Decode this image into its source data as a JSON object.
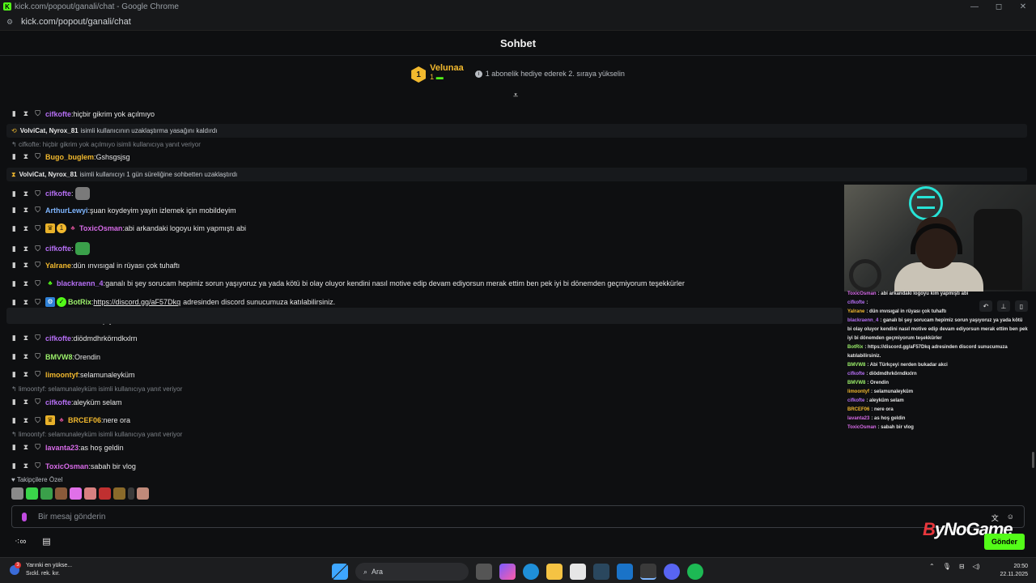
{
  "browser": {
    "window_title": "kick.com/popout/ganali/chat - Google Chrome",
    "url": "kick.com/popout/ganali/chat"
  },
  "header": {
    "title": "Sohbet"
  },
  "top_gifter": {
    "rank": "1",
    "name": "Velunaa",
    "count": "1",
    "message": "1 abonelik hediye ederek 2. sıraya yükselin"
  },
  "colors": {
    "accent": "#53fc18",
    "purple": "#b66ff5",
    "blue_user": "#7fb6ff",
    "yellow_user": "#f2b92e",
    "green_user": "#9cf06b",
    "pink_user": "#d76be8"
  },
  "chat": {
    "messages": [
      {
        "type": "msg",
        "user": "cifkofte",
        "color": "#b66ff5",
        "text": "hiçbir gikrim yok açılmıyo"
      },
      {
        "type": "sys",
        "actors": "VolviCat, Nyrox_81",
        "text": "isimli kullanıcının uzaklaştırma yasağını kaldırdı",
        "icon": "unban-icon"
      },
      {
        "type": "reply",
        "text": "cifkofte: hiçbir gikrim yok açılmıyo isimli kullanıcıya yanıt veriyor"
      },
      {
        "type": "msg",
        "user": "Bugo_buglem",
        "color": "#f2b92e",
        "text": "Gshsgsjsg"
      },
      {
        "type": "sys",
        "actors": "VolviCat, Nyrox_81",
        "text": "isimli kullanıcıyı 1 gün süreliğine sohbetten uzaklaştırdı",
        "icon": "timeout-icon"
      },
      {
        "type": "msg",
        "user": "cifkofte",
        "color": "#b66ff5",
        "text": ""
      },
      {
        "type": "msg",
        "user": "ArthurLewyi",
        "color": "#7fb6ff",
        "text": "şuan koydeyim yayin izlemek için mobildeyim"
      },
      {
        "type": "msg",
        "user": "ToxicOsman",
        "color": "#d76be8",
        "text": "abi arkandaki logoyu kim yapmıştı abi"
      },
      {
        "type": "msg",
        "user": "cifkofte",
        "color": "#b66ff5",
        "text": ""
      },
      {
        "type": "msg",
        "user": "Yalrane",
        "color": "#f2b92e",
        "text": "dün ınvısıgal in rüyası çok tuhaftı"
      },
      {
        "type": "msg",
        "user": "blackraenn_4",
        "color": "#b66ff5",
        "text": "ganalı bi şey sorucam hepimiz sorun yaşıyoruz ya yada kötü bi olay oluyor kendini nasıl motive edip devam ediyorsun merak ettim ben pek iyi bi dönemden geçmiyorum teşekkürler"
      },
      {
        "type": "msg",
        "user": "BotRix",
        "color": "#9cf06b",
        "link": "https://discord.gg/aF57Dkq",
        "text": "adresinden discord sunucumuza katılabilirsiniz."
      },
      {
        "type": "msg",
        "user": "BMVW8",
        "color": "#9cf06b",
        "text": "Abi Türkçeyi nerden bukadar akci"
      },
      {
        "type": "msg",
        "user": "cifkofte",
        "color": "#b66ff5",
        "text": "diödmdhrkörndkxlrn"
      },
      {
        "type": "msg",
        "user": "BMVW8",
        "color": "#9cf06b",
        "text": "Orendin"
      },
      {
        "type": "msg",
        "user": "limoontyf",
        "color": "#f2b92e",
        "text": "selamunaleyküm"
      },
      {
        "type": "reply",
        "text": "limoontyf: selamunaleyküm isimli kullanıcıya yanıt veriyor"
      },
      {
        "type": "msg",
        "user": "cifkofte",
        "color": "#b66ff5",
        "text": "aleyküm selam"
      },
      {
        "type": "msg",
        "user": "BRCEF06",
        "color": "#f2b92e",
        "text": "nere ora"
      },
      {
        "type": "reply",
        "text": "limoontyf: selamunaleyküm isimli kullanıcıya yanıt veriyor"
      },
      {
        "type": "msg",
        "user": "lavanta23",
        "color": "#d76be8",
        "text": "as hoş geldin"
      },
      {
        "type": "msg",
        "user": "ToxicOsman",
        "color": "#d76be8",
        "text": "sabah bir vlog"
      }
    ]
  },
  "followers_label": "Takipçilere Özel",
  "input": {
    "placeholder": "Bir mesaj gönderin",
    "send_label": "Gönder"
  },
  "watermark": {
    "part1": "B",
    "part2": "yNoGame"
  },
  "overlay": {
    "lines": [
      {
        "user": "ToxicOsman",
        "text": "abi arkandaki logoyu kim yapmıştı abi"
      },
      {
        "user": "cifkofte",
        "text": ""
      },
      {
        "user": "Yalrane",
        "text": "dün ınvısıgal in rüyası çok tuhaftı"
      },
      {
        "user": "blackraenn_4",
        "text": "ganalı bi şey sorucam hepimiz sorun yaşıyoruz ya yada kötü"
      },
      {
        "user": "",
        "text": "bi olay oluyor kendini nasıl motive edip devam ediyorsun merak ettim ben pek"
      },
      {
        "user": "",
        "text": "iyi bi dönemden geçmiyorum teşekkürler"
      },
      {
        "user": "BotRix",
        "text": "https://discord.gg/aF57Dkq adresinden discord sunucumuza"
      },
      {
        "user": "",
        "text": "katılabilirsiniz."
      },
      {
        "user": "BMVW8",
        "text": "Abi Türkçeyi nerden bukadar akci"
      },
      {
        "user": "cifkofte",
        "text": "diödmdhrkörndkxlrn"
      },
      {
        "user": "BMVW8",
        "text": "Orendin"
      },
      {
        "user": "limoontyf",
        "text": "selamunaleyküm"
      },
      {
        "user": "cifkofte",
        "text": "aleyküm selam"
      },
      {
        "user": "BRCEF06",
        "text": "nere ora"
      },
      {
        "user": "lavanta23",
        "text": "as hoş geldin"
      },
      {
        "user": "ToxicOsman",
        "text": "sabah bir vlog"
      }
    ]
  },
  "taskbar": {
    "weather_line1": "Yarınki en yükse...",
    "weather_line2": "Sıckl. rek. kır.",
    "search_label": "Ara",
    "time": "20:50",
    "date": "22.11.2025"
  }
}
